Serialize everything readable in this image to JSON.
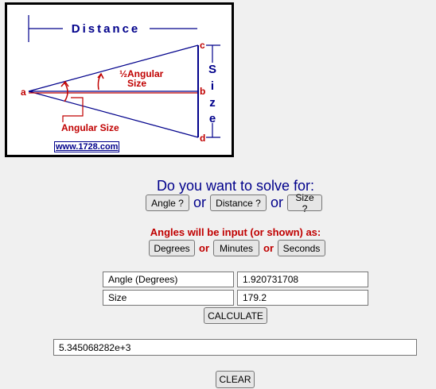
{
  "diagram": {
    "title": "Distance",
    "size_label": "Size",
    "half_angle_label_top": "½Angular",
    "half_angle_label_bottom": "Size",
    "angular_size_label": "Angular Size",
    "point_a": "a",
    "point_b": "b",
    "point_c": "c",
    "point_d": "d",
    "website": "www.1728.com"
  },
  "solve": {
    "question": "Do you want to solve for:",
    "angle_button": "Angle ?",
    "distance_button": "Distance ?",
    "size_button": "Size ?",
    "or": "or"
  },
  "units": {
    "label": "Angles will be input (or shown) as:",
    "degrees_button": "Degrees",
    "minutes_button": "Minutes",
    "seconds_button": "Seconds",
    "or": "or"
  },
  "inputs": {
    "row1_label": "Angle (Degrees)",
    "row1_value": "1.920731708",
    "row2_label": "Size",
    "row2_value": "179.2"
  },
  "calculate_button": "CALCULATE",
  "result": "5.345068282e+3",
  "clear_button": "CLEAR",
  "colors": {
    "blue": "#00008b",
    "red": "#c00000"
  }
}
